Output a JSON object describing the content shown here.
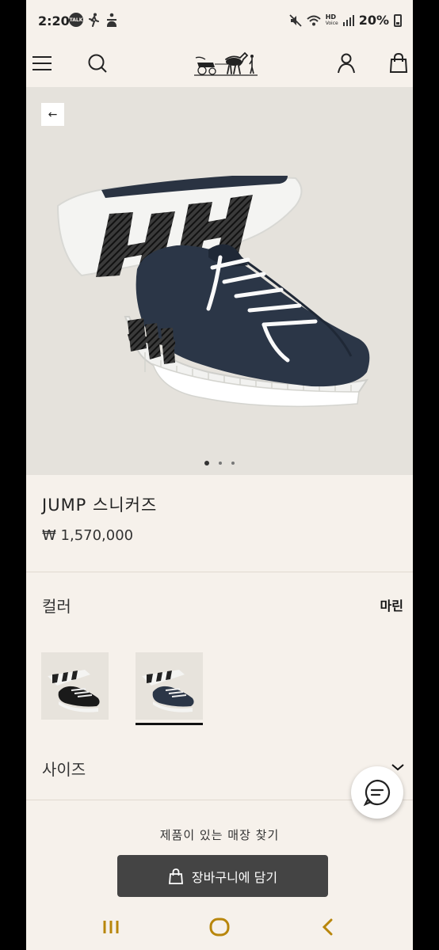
{
  "status_bar": {
    "time": "2:20",
    "talk_badge": "TALK",
    "hd_top": "HD",
    "hd_bottom": "Voice",
    "battery": "20%"
  },
  "header": {
    "icons": [
      "menu-icon",
      "search-icon",
      "brand-logo",
      "account-icon",
      "shopping-bag-icon"
    ]
  },
  "product": {
    "image_dots": {
      "count": 3,
      "active_index": 0
    },
    "back_glyph": "←",
    "title": "JUMP 스니커즈",
    "price": "₩ 1,570,000",
    "color_label": "컬러",
    "color_value": "마린",
    "swatches": [
      {
        "name": "black",
        "selected": false
      },
      {
        "name": "marine",
        "selected": true
      }
    ],
    "size_label": "사이즈",
    "store_link": "제품이 있는 매장 찾기",
    "add_to_cart_label": "장바구니에 담기"
  },
  "colors": {
    "background": "#f6f1eb",
    "hero_bg": "#e5e2dc",
    "shoe_navy": "#2b3647",
    "cart_button": "#444444"
  },
  "nav_bar": {
    "icons": [
      "recent-apps-icon",
      "home-icon",
      "back-icon"
    ]
  }
}
